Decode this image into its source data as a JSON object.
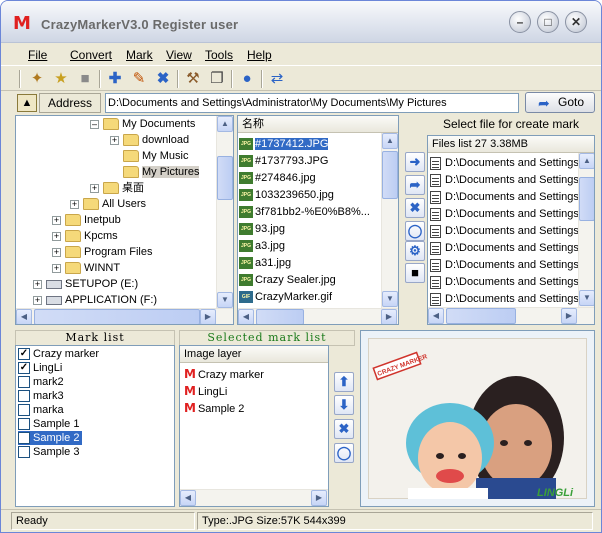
{
  "window": {
    "title": "CrazyMarkerV3.0 Register user",
    "logo": "M"
  },
  "menu": [
    "File",
    "Convert",
    "Mark",
    "View",
    "Tools",
    "Help"
  ],
  "address": {
    "label": "Address",
    "value": "D:\\Documents and Settings\\Administrator\\My Documents\\My Pictures",
    "go_label": "Goto"
  },
  "tree": [
    {
      "label": "My Documents",
      "expander": "-"
    },
    {
      "label": "download",
      "expander": "+"
    },
    {
      "label": "My Music",
      "expander": ""
    },
    {
      "label": "My Pictures",
      "expander": "",
      "selected": true
    },
    {
      "label": "桌面",
      "expander": "+"
    },
    {
      "label": "All Users",
      "expander": "+"
    },
    {
      "label": "Inetpub",
      "expander": "+"
    },
    {
      "label": "Kpcms",
      "expander": "+"
    },
    {
      "label": "Program Files",
      "expander": "+"
    },
    {
      "label": "WINNT",
      "expander": "+"
    },
    {
      "label": "SETUPOP (E:)",
      "expander": "+"
    },
    {
      "label": "APPLICATION (F:)",
      "expander": "+"
    }
  ],
  "files": {
    "header": "名称",
    "items": [
      {
        "name": "#1737412.JPG",
        "icon": "JPG",
        "selected": true
      },
      {
        "name": "#1737793.JPG",
        "icon": "JPG"
      },
      {
        "name": "#274846.jpg",
        "icon": "JPG"
      },
      {
        "name": "1033239650.jpg",
        "icon": "JPG"
      },
      {
        "name": "3f781bb2-%E0%B8%...",
        "icon": "JPG"
      },
      {
        "name": "93.jpg",
        "icon": "JPG"
      },
      {
        "name": "a3.jpg",
        "icon": "JPG"
      },
      {
        "name": "a31.jpg",
        "icon": "JPG"
      },
      {
        "name": "Crazy Sealer.jpg",
        "icon": "JPG"
      },
      {
        "name": "CrazyMarker.gif",
        "icon": "GIF"
      }
    ]
  },
  "create_mark": {
    "title": "Select file for create mark",
    "header": "Files list 27  3.38MB",
    "items": [
      "D:\\Documents and Settings'",
      "D:\\Documents and Settings'",
      "D:\\Documents and Settings'",
      "D:\\Documents and Settings'",
      "D:\\Documents and Settings'",
      "D:\\Documents and Settings'",
      "D:\\Documents and Settings'",
      "D:\\Documents and Settings'",
      "D:\\Documents and Settings'"
    ]
  },
  "mark_list": {
    "title": "Mark list",
    "items": [
      {
        "label": "Crazy marker",
        "checked": true
      },
      {
        "label": "LingLi",
        "checked": true
      },
      {
        "label": "mark2",
        "checked": false
      },
      {
        "label": "mark3",
        "checked": false
      },
      {
        "label": "marka",
        "checked": false
      },
      {
        "label": "Sample 1",
        "checked": false
      },
      {
        "label": "Sample 2",
        "checked": false,
        "selected": true
      },
      {
        "label": "Sample 3",
        "checked": false
      }
    ]
  },
  "selected_mark_list": {
    "title": "Selected mark list",
    "header": "Image layer",
    "items": [
      "Crazy marker",
      "LingLi",
      "Sample 2"
    ]
  },
  "preview": {
    "stamp_text": "CRAZY MARKER",
    "signature": "LINGLi"
  },
  "status": {
    "left": "Ready",
    "right": "Type:.JPG Size:57K 544x399"
  },
  "colors": {
    "selection": "#316ac5",
    "brand_red": "#e02020",
    "toolbar_blue": "#2b63c6"
  }
}
